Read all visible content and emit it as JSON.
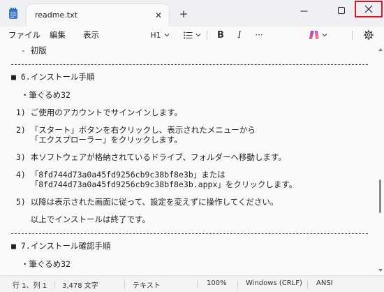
{
  "window": {
    "tab_title": "readme.txt",
    "new_tab_symbol": "+",
    "minimize_symbol": "—",
    "maximize_symbol": "☐",
    "close_symbol": "✕"
  },
  "menu": {
    "file": "ファイル",
    "edit": "編集",
    "view": "表示"
  },
  "toolbar": {
    "heading_label": "H1",
    "list_symbol": "☰",
    "bold_label": "B",
    "italic_label": "I",
    "more_label": "···"
  },
  "document": {
    "lines": [
      "  - 初版",
      "■ 6.インストール手順",
      "  ・筆ぐるめ32",
      " 1) ご使用のアカウントでサインインします。",
      " 2) 「スタート」ボタンを右クリックし、表示されたメニューから",
      "    「エクスプローラー」をクリックします。",
      " 3) 本ソフトウェアが格納されているドライブ、フォルダーへ移動します。",
      " 4) 「8fd744d73a0a45fd9256cb9c38bf8e3b」または",
      "    「8fd744d73a0a45fd9256cb9c38bf8e3b.appx」をクリックします。",
      " 5) 以降は表示された画面に従って、設定を変えずに操作してください。",
      "    以上でインストールは終了です。",
      "■ 7.インストール確認手順",
      "  ・筆ぐるめ32"
    ]
  },
  "status": {
    "position": "行 1、列 1",
    "char_count": "3,478 文字",
    "format": "テキスト",
    "zoom": "100%",
    "line_ending": "Windows (CRLF)",
    "encoding": "ANSI"
  },
  "colors": {
    "close_highlight": "#e0141e",
    "copilot_gradient": [
      "#1f6feb",
      "#e0449b",
      "#f5a623"
    ]
  },
  "icons": [
    "notepad-app-icon",
    "close-icon",
    "new-tab-icon",
    "minimize-icon",
    "maximize-icon",
    "list-icon",
    "copilot-icon",
    "settings-gear-icon",
    "scroll-up-arrow-icon",
    "scroll-down-arrow-icon"
  ]
}
